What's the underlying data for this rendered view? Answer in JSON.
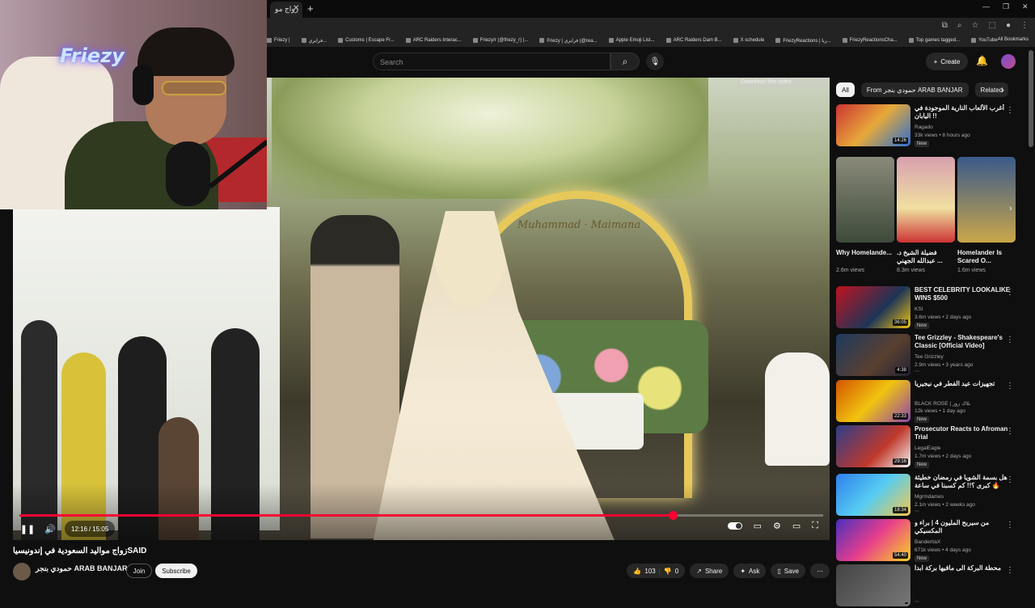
{
  "browser": {
    "tab_title": "زواج مو",
    "new_tab": "+",
    "window_controls": [
      "—",
      "❐",
      "✕"
    ],
    "bookmarks": [
      "Friezy |",
      "فرايزي...",
      "Customs | Escape Fr...",
      "ARC Raiders Interac...",
      "Friezy/r (@friezy_r) |...",
      "Friezy | فرايزي (@rea...",
      "Apple Emoji List...",
      "ARC Raiders Dam B...",
      "X schedule",
      "FriezyReactions | ريا...",
      "FriezyReactionsCha...",
      "Top games tagged...",
      "YouTube"
    ],
    "bookmarks_all": "All Bookmarks"
  },
  "header": {
    "search_placeholder": "Search",
    "create_label": "Create"
  },
  "video": {
    "download_badge": "Download this video",
    "arch_text": "Muhammad · Maimana",
    "time_current": "12:16",
    "time_sep": "/",
    "time_total": "15:05",
    "progress_fraction": 0.813
  },
  "webcam": {
    "neon_sign": "Friezy"
  },
  "meta": {
    "title": "زواج مواليد السعودية في إندونيسياSAID",
    "channel_name": "حمودي بنجر ARAB BANJAR",
    "channel_subs": "",
    "join_label": "Join",
    "subscribe_label": "Subscribe",
    "likes": "103",
    "dislikes": "0",
    "share_label": "Share",
    "ask_label": "Ask",
    "save_label": "Save"
  },
  "sidebar": {
    "chips": [
      "All",
      "From حمودي بنجر ARAB BANJAR",
      "Related"
    ],
    "recs": [
      {
        "title": "أغرب الألعاب النارية الموجودة في اليابان !!",
        "channel": "Ragado",
        "meta": "33k views • 8 hours ago",
        "new": "New",
        "duration": "14:26",
        "thumb": "linear-gradient(135deg,#c33,#e7a93a 50%,#2a6fd1)"
      },
      {
        "title": "BEST CELEBRITY LOOKALIKE WINS $500",
        "channel": "KSI",
        "meta": "3.6m views • 2 days ago",
        "new": "New",
        "duration": "36:05",
        "thumb": "linear-gradient(135deg,#c1121f,#1d3557 60%,#f1c40f)"
      },
      {
        "title": "Tee Grizzley - Shakespeare's Classic [Official Video]",
        "channel": "Tee Grizzley",
        "meta": "2.9m views • 3 years ago",
        "new": "",
        "duration": "4:38",
        "thumb": "linear-gradient(135deg,#1e3a5f,#5a4030 60%,#223)"
      },
      {
        "title": "تجهيزات عيد الفطر في نيجيريا",
        "channel": "BLACK ROSE | بلاك روز",
        "meta": "12k views • 1 day ago",
        "new": "New",
        "duration": "22:33",
        "thumb": "linear-gradient(135deg,#d35400,#f1c40f 50%,#8e44ad)"
      },
      {
        "title": "Prosecutor Reacts to Afroman Trial",
        "channel": "LegalEagle",
        "meta": "1.7m views • 2 days ago",
        "new": "New",
        "duration": "29:16",
        "thumb": "linear-gradient(135deg,#2d3e8a,#c0392b 60%,#f4f4f4)"
      },
      {
        "title": "هل بسمة الشويا في رمضان خطيئة كبرى ؟!! كم كسبنا في ساعة 🔥",
        "channel": "Mgrmdames",
        "meta": "2.1m views • 2 weeks ago",
        "new": "",
        "duration": "18:34",
        "thumb": "linear-gradient(135deg,#2f80ed,#56ccf2 50%,#f2c94c)"
      },
      {
        "title": "من سيربح المليون 4 | براء و المكسيكي",
        "channel": "BanderitaX",
        "meta": "671k views • 4 days ago",
        "new": "New",
        "duration": "54:40",
        "thumb": "linear-gradient(135deg,#4a2fbd,#e83e8c 50%,#f9d423)"
      },
      {
        "title": "محطة البركة الى ماقيها بركة ابدا",
        "channel": "",
        "meta": "",
        "new": "",
        "duration": "",
        "thumb": "linear-gradient(135deg,#444,#777)"
      }
    ],
    "shorts": [
      {
        "title": "Why Homelande...",
        "views": "2.6m views",
        "thumb": "linear-gradient(180deg,#8a8a7a,#3d4a3a)"
      },
      {
        "title": "فضيلة الشيخ د. عبدالله الجهني ...",
        "views": "8.3m views",
        "thumb": "linear-gradient(180deg,#d8a0b0,#f0e0a0 60%,#c33)"
      },
      {
        "title": "Homelander Is Scared O...",
        "views": "1.6m views",
        "thumb": "linear-gradient(180deg,#3a5a8a,#c9a64a)"
      }
    ]
  }
}
